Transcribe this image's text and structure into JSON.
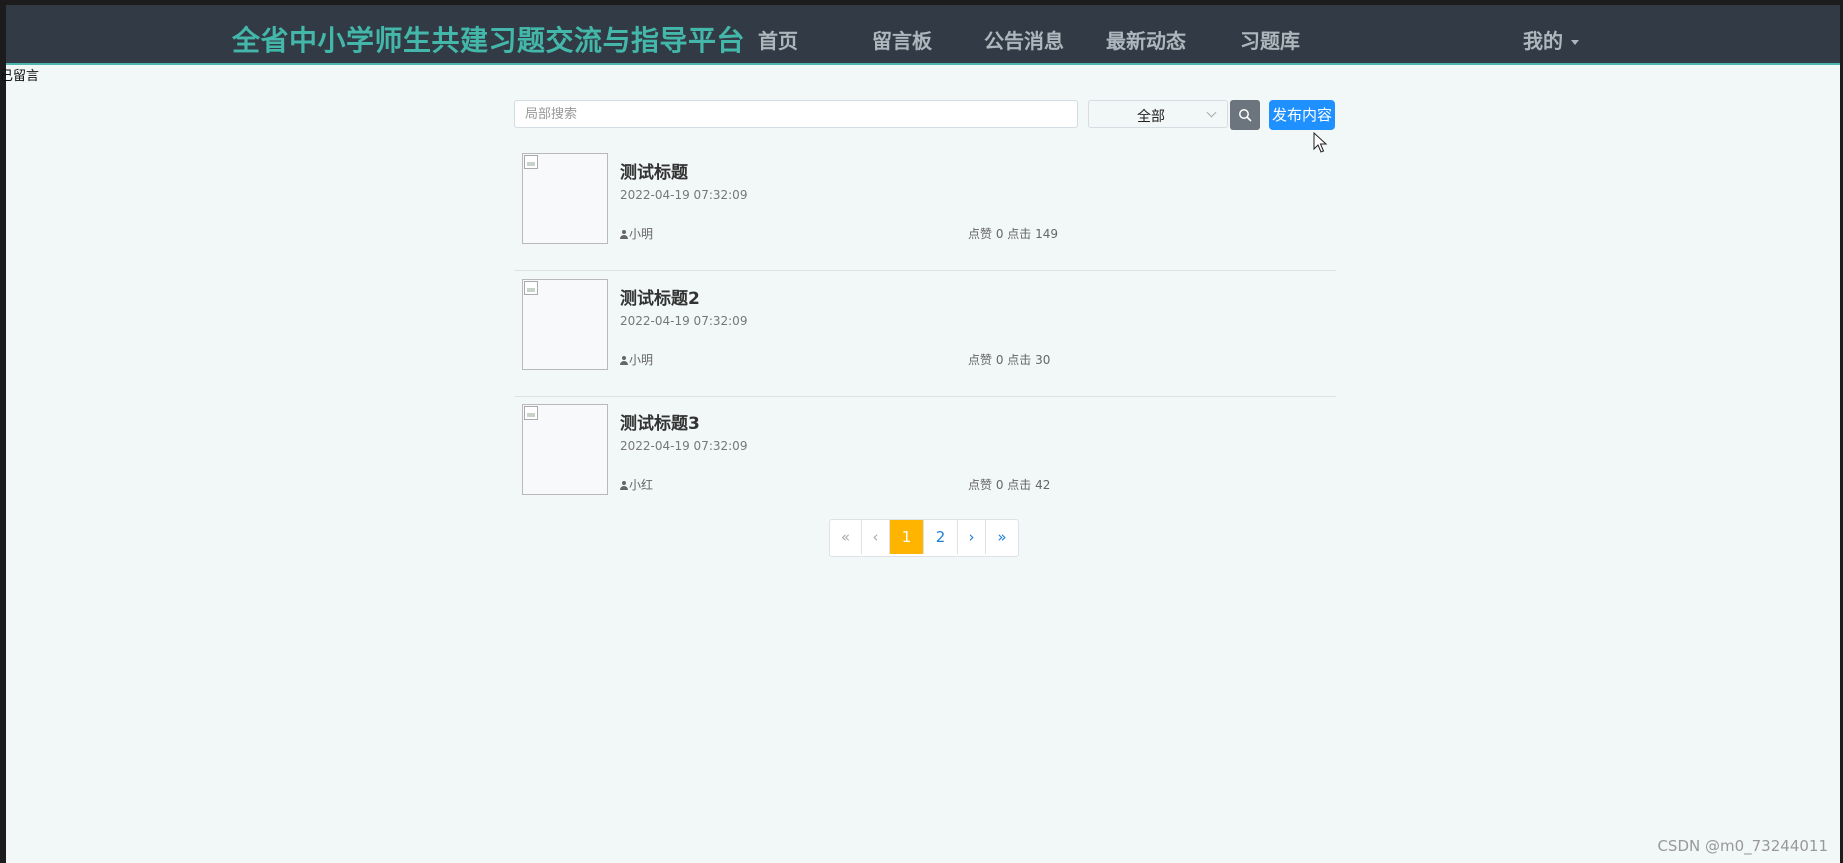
{
  "navbar": {
    "brand": "全省中小学师生共建习题交流与指导平台",
    "items": [
      {
        "label": "首页"
      },
      {
        "label": "留言板"
      },
      {
        "label": "公告消息"
      },
      {
        "label": "最新动态"
      },
      {
        "label": "习题库"
      }
    ],
    "user_menu_label": "我的"
  },
  "stray_text": "已留言",
  "search": {
    "placeholder": "局部搜索",
    "value": "",
    "select_value": "全部",
    "publish_label": "发布内容"
  },
  "list": [
    {
      "title": "测试标题",
      "date": "2022-04-19 07:32:09",
      "author": "小明",
      "stats": "点赞 0 点击 149"
    },
    {
      "title": "测试标题2",
      "date": "2022-04-19 07:32:09",
      "author": "小明",
      "stats": "点赞 0 点击 30"
    },
    {
      "title": "测试标题3",
      "date": "2022-04-19 07:32:09",
      "author": "小红",
      "stats": "点赞 0 点击 42"
    }
  ],
  "pagination": {
    "first": "«",
    "prev": "‹",
    "pages": [
      "1",
      "2"
    ],
    "active_page": "1",
    "next": "›",
    "last": "»"
  },
  "watermark": "CSDN @m0_73244011",
  "colors": {
    "navbar_bg": "#323b45",
    "brand": "#43b7a9",
    "publish": "#1e90ff",
    "page_active": "#ffb400"
  }
}
